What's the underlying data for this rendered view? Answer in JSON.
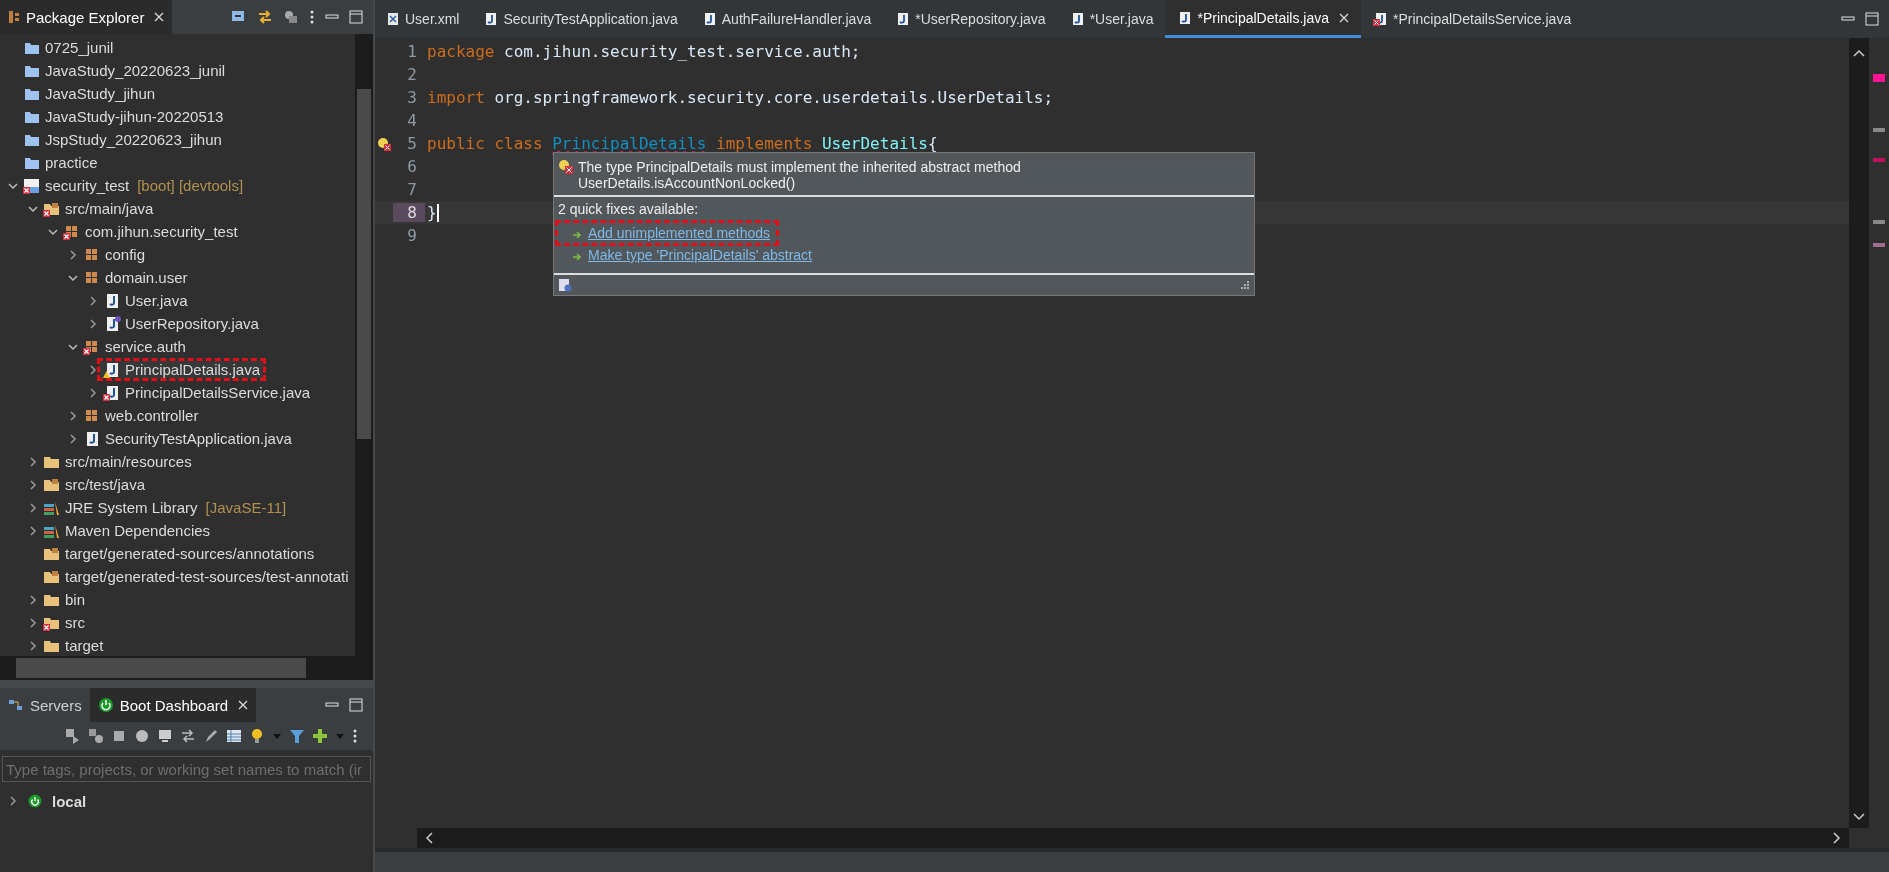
{
  "explorer": {
    "title": "Package Explorer",
    "tree": [
      {
        "label": "0725_junil",
        "kind": "project"
      },
      {
        "label": "JavaStudy_20220623_junil",
        "kind": "project"
      },
      {
        "label": "JavaStudy_jihun",
        "kind": "project"
      },
      {
        "label": "JavaStudy-jihun-20220513",
        "kind": "project"
      },
      {
        "label": "JspStudy_20220623_jihun",
        "kind": "project"
      },
      {
        "label": "practice",
        "kind": "project"
      },
      {
        "label": "security_test",
        "suffix": "[boot] [devtools]",
        "kind": "boot-project",
        "expanded": true,
        "error": true,
        "children": [
          {
            "label": "src/main/java",
            "kind": "source-folder",
            "expanded": true,
            "error": true,
            "children": [
              {
                "label": "com.jihun.security_test",
                "kind": "package",
                "expanded": true,
                "error": true,
                "children": [
                  {
                    "label": "config",
                    "kind": "package",
                    "expanded": false
                  },
                  {
                    "label": "domain.user",
                    "kind": "package",
                    "expanded": true,
                    "children": [
                      {
                        "label": "User.java",
                        "kind": "java-file",
                        "expanded": false
                      },
                      {
                        "label": "UserRepository.java",
                        "kind": "interface-file",
                        "expanded": false
                      }
                    ]
                  },
                  {
                    "label": "service.auth",
                    "kind": "package",
                    "expanded": true,
                    "error": true,
                    "children": [
                      {
                        "label": "PrincipalDetails.java",
                        "kind": "java-file",
                        "expanded": false,
                        "warning": true,
                        "marked": true
                      },
                      {
                        "label": "PrincipalDetailsService.java",
                        "kind": "java-file",
                        "expanded": false,
                        "error": true
                      }
                    ]
                  },
                  {
                    "label": "web.controller",
                    "kind": "package",
                    "expanded": false
                  },
                  {
                    "label": "SecurityTestApplication.java",
                    "kind": "java-file",
                    "expanded": false
                  }
                ]
              }
            ]
          },
          {
            "label": "src/main/resources",
            "kind": "folder",
            "expanded": false
          },
          {
            "label": "src/test/java",
            "kind": "source-folder",
            "expanded": false
          },
          {
            "label": "JRE System Library",
            "suffix": "[JavaSE-11]",
            "kind": "library",
            "expanded": false
          },
          {
            "label": "Maven Dependencies",
            "kind": "library",
            "expanded": false
          },
          {
            "label": "target/generated-sources/annotations",
            "kind": "source-folder"
          },
          {
            "label": "target/generated-test-sources/test-annotati",
            "kind": "source-folder"
          },
          {
            "label": "bin",
            "kind": "folder",
            "expanded": false
          },
          {
            "label": "src",
            "kind": "folder",
            "expanded": false,
            "error": true
          },
          {
            "label": "target",
            "kind": "folder",
            "expanded": false
          }
        ]
      }
    ]
  },
  "dashboard": {
    "tabs": [
      {
        "label": "Servers",
        "selected": false
      },
      {
        "label": "Boot Dashboard",
        "selected": true
      }
    ],
    "filter": {
      "placeholder": "Type tags, projects, or working set names to match (ir"
    },
    "items": [
      {
        "label": "local",
        "expanded": false
      }
    ]
  },
  "editor": {
    "tabs": [
      {
        "label": "User.xml",
        "kind": "xml",
        "selected": false
      },
      {
        "label": "SecurityTestApplication.java",
        "kind": "java",
        "selected": false
      },
      {
        "label": "AuthFailureHandler.java",
        "kind": "java",
        "selected": false
      },
      {
        "label": "*UserRepository.java",
        "kind": "java",
        "selected": false
      },
      {
        "label": "*User.java",
        "kind": "java",
        "selected": false
      },
      {
        "label": "*PrincipalDetails.java",
        "kind": "java",
        "selected": true
      },
      {
        "label": "*PrincipalDetailsService.java",
        "kind": "java-error",
        "selected": false
      }
    ],
    "lines": [
      {
        "number": "1",
        "tokens": [
          {
            "kind": "keyword",
            "text": "package"
          },
          {
            "kind": "plain",
            "text": " com.jihun.security_test.service.auth;"
          }
        ]
      },
      {
        "number": "2"
      },
      {
        "number": "3",
        "tokens": [
          {
            "kind": "keyword",
            "text": "import"
          },
          {
            "kind": "plain",
            "text": " org.springframework.security.core.userdetails.UserDetails;"
          }
        ]
      },
      {
        "number": "4"
      },
      {
        "number": "5",
        "error": true,
        "tokens": [
          {
            "kind": "keyword",
            "text": "public class "
          },
          {
            "kind": "class",
            "text": "PrincipalDetails"
          },
          {
            "kind": "keyword",
            "text": " implements "
          },
          {
            "kind": "interface",
            "text": "UserDetails"
          },
          {
            "kind": "plain",
            "text": "{"
          }
        ]
      },
      {
        "number": "6"
      },
      {
        "number": "7"
      },
      {
        "number": "8",
        "current": true,
        "tokens": [
          {
            "kind": "plain",
            "text": "}"
          }
        ]
      },
      {
        "number": "9"
      }
    ],
    "hover": {
      "message": [
        "The type PrincipalDetails must implement the inherited abstract method",
        "UserDetails.isAccountNonLocked()"
      ],
      "fixes_heading": "2 quick fixes available:",
      "fixes": [
        {
          "label": "Add unimplemented methods",
          "marked": true
        },
        {
          "label": "Make type 'PrincipalDetails' abstract",
          "marked": false
        }
      ]
    }
  }
}
